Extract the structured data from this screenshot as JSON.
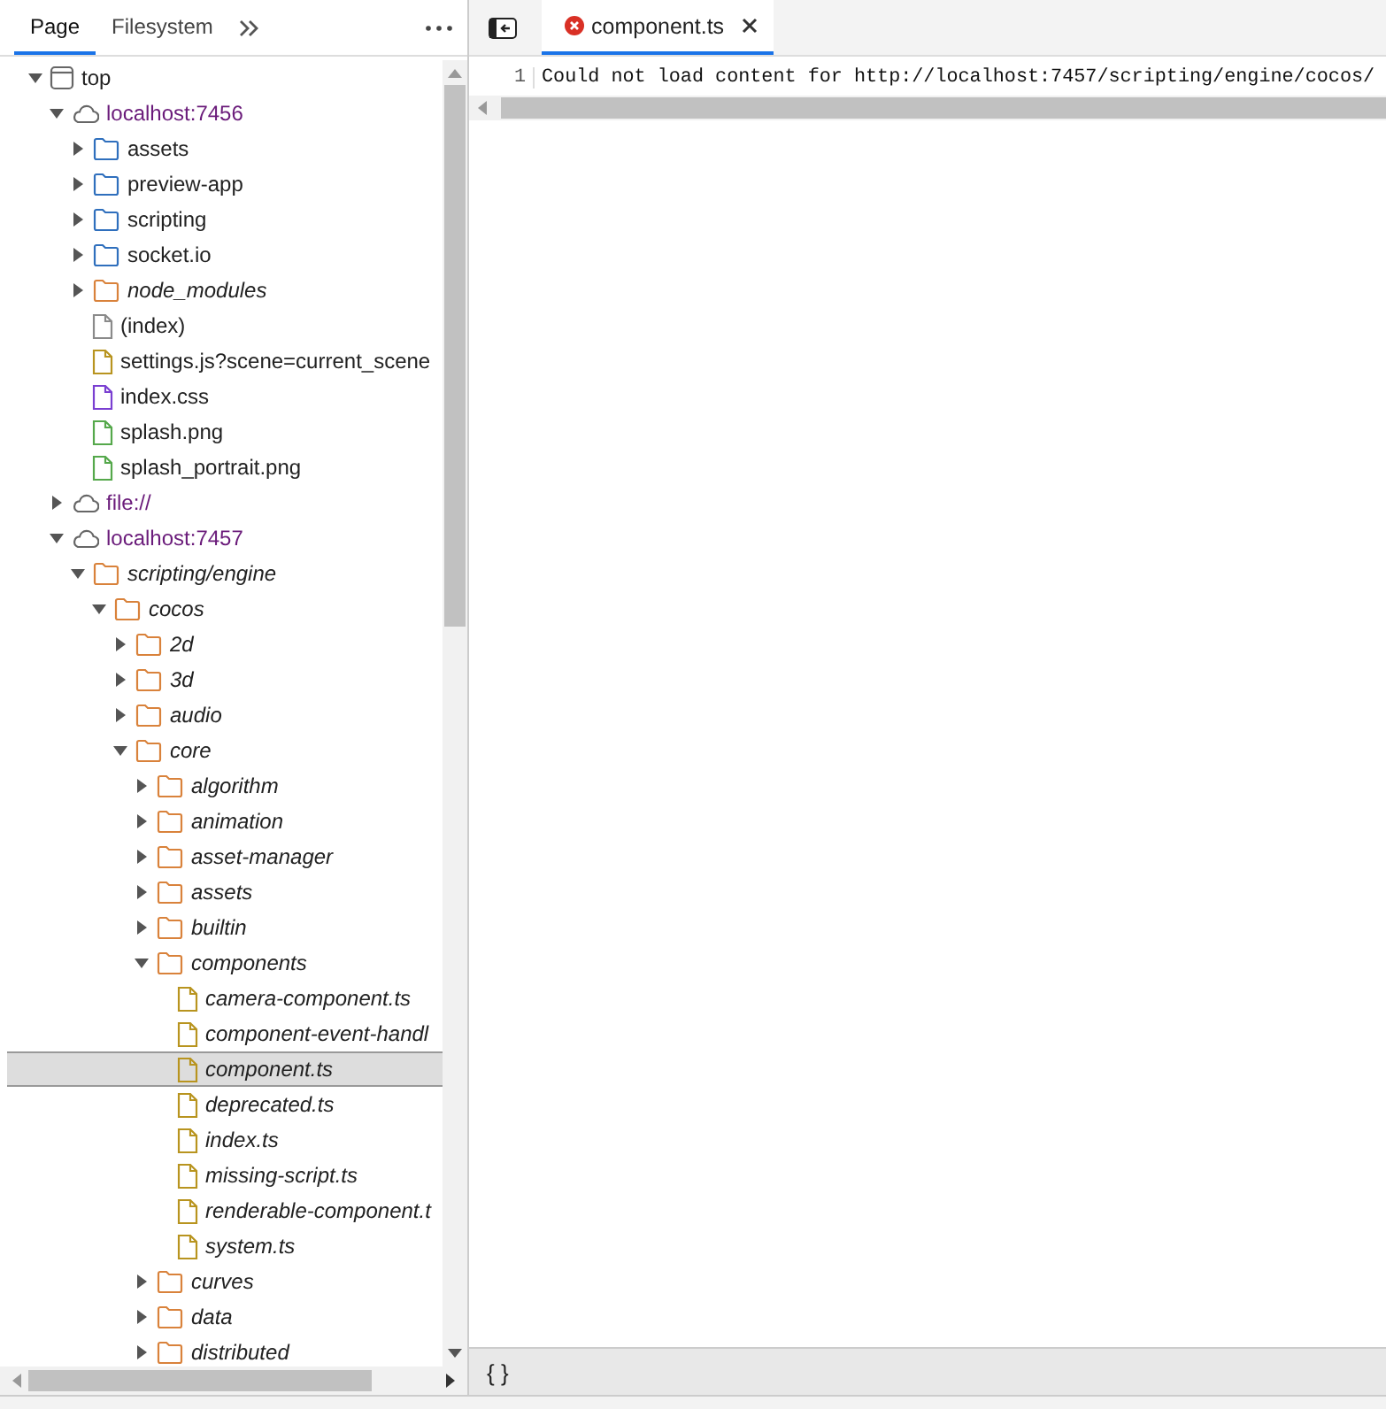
{
  "navigator": {
    "tabs": [
      {
        "label": "Page",
        "selected": true
      },
      {
        "label": "Filesystem",
        "selected": false
      }
    ],
    "tree": [
      {
        "label": "top",
        "kind": "frame",
        "expanded": true,
        "selected": false,
        "children": [
          {
            "label": "localhost:7456",
            "kind": "origin",
            "expanded": true,
            "selected": false,
            "children": [
              {
                "label": "assets",
                "kind": "folder",
                "color": "#2f6fbd",
                "italic": false,
                "expanded": false,
                "selected": false
              },
              {
                "label": "preview-app",
                "kind": "folder",
                "color": "#2f6fbd",
                "italic": false,
                "expanded": false,
                "selected": false
              },
              {
                "label": "scripting",
                "kind": "folder",
                "color": "#2f6fbd",
                "italic": false,
                "expanded": false,
                "selected": false
              },
              {
                "label": "socket.io",
                "kind": "folder",
                "color": "#2f6fbd",
                "italic": false,
                "expanded": false,
                "selected": false
              },
              {
                "label": "node_modules",
                "kind": "folder",
                "color": "#d9823b",
                "italic": true,
                "expanded": false,
                "selected": false
              },
              {
                "label": "(index)",
                "kind": "file",
                "color": "#8a8a8a",
                "italic": false,
                "selected": false
              },
              {
                "label": "settings.js?scene=current_scene",
                "kind": "file",
                "color": "#b8941f",
                "italic": false,
                "selected": false
              },
              {
                "label": "index.css",
                "kind": "file",
                "color": "#7a3fd1",
                "italic": false,
                "selected": false
              },
              {
                "label": "splash.png",
                "kind": "file",
                "color": "#55a84b",
                "italic": false,
                "selected": false
              },
              {
                "label": "splash_portrait.png",
                "kind": "file",
                "color": "#55a84b",
                "italic": false,
                "selected": false
              }
            ]
          },
          {
            "label": "file://",
            "kind": "origin",
            "expanded": false,
            "selected": false
          },
          {
            "label": "localhost:7457",
            "kind": "origin",
            "expanded": true,
            "selected": false,
            "children": [
              {
                "label": "scripting/engine",
                "kind": "folder",
                "color": "#d9823b",
                "italic": true,
                "expanded": true,
                "selected": false,
                "children": [
                  {
                    "label": "cocos",
                    "kind": "folder",
                    "color": "#d9823b",
                    "italic": true,
                    "expanded": true,
                    "selected": false,
                    "children": [
                      {
                        "label": "2d",
                        "kind": "folder",
                        "color": "#d9823b",
                        "italic": true,
                        "expanded": false,
                        "selected": false
                      },
                      {
                        "label": "3d",
                        "kind": "folder",
                        "color": "#d9823b",
                        "italic": true,
                        "expanded": false,
                        "selected": false
                      },
                      {
                        "label": "audio",
                        "kind": "folder",
                        "color": "#d9823b",
                        "italic": true,
                        "expanded": false,
                        "selected": false
                      },
                      {
                        "label": "core",
                        "kind": "folder",
                        "color": "#d9823b",
                        "italic": true,
                        "expanded": true,
                        "selected": false,
                        "children": [
                          {
                            "label": "algorithm",
                            "kind": "folder",
                            "color": "#d9823b",
                            "italic": true,
                            "expanded": false,
                            "selected": false
                          },
                          {
                            "label": "animation",
                            "kind": "folder",
                            "color": "#d9823b",
                            "italic": true,
                            "expanded": false,
                            "selected": false
                          },
                          {
                            "label": "asset-manager",
                            "kind": "folder",
                            "color": "#d9823b",
                            "italic": true,
                            "expanded": false,
                            "selected": false
                          },
                          {
                            "label": "assets",
                            "kind": "folder",
                            "color": "#d9823b",
                            "italic": true,
                            "expanded": false,
                            "selected": false
                          },
                          {
                            "label": "builtin",
                            "kind": "folder",
                            "color": "#d9823b",
                            "italic": true,
                            "expanded": false,
                            "selected": false
                          },
                          {
                            "label": "components",
                            "kind": "folder",
                            "color": "#d9823b",
                            "italic": true,
                            "expanded": true,
                            "selected": false,
                            "children": [
                              {
                                "label": "camera-component.ts",
                                "kind": "file",
                                "color": "#b8941f",
                                "italic": true,
                                "selected": false
                              },
                              {
                                "label": "component-event-handl",
                                "kind": "file",
                                "color": "#b8941f",
                                "italic": true,
                                "selected": false
                              },
                              {
                                "label": "component.ts",
                                "kind": "file",
                                "color": "#b8941f",
                                "italic": true,
                                "selected": true
                              },
                              {
                                "label": "deprecated.ts",
                                "kind": "file",
                                "color": "#b8941f",
                                "italic": true,
                                "selected": false
                              },
                              {
                                "label": "index.ts",
                                "kind": "file",
                                "color": "#b8941f",
                                "italic": true,
                                "selected": false
                              },
                              {
                                "label": "missing-script.ts",
                                "kind": "file",
                                "color": "#b8941f",
                                "italic": true,
                                "selected": false
                              },
                              {
                                "label": "renderable-component.t",
                                "kind": "file",
                                "color": "#b8941f",
                                "italic": true,
                                "selected": false
                              },
                              {
                                "label": "system.ts",
                                "kind": "file",
                                "color": "#b8941f",
                                "italic": true,
                                "selected": false
                              }
                            ]
                          },
                          {
                            "label": "curves",
                            "kind": "folder",
                            "color": "#d9823b",
                            "italic": true,
                            "expanded": false,
                            "selected": false
                          },
                          {
                            "label": "data",
                            "kind": "folder",
                            "color": "#d9823b",
                            "italic": true,
                            "expanded": false,
                            "selected": false
                          },
                          {
                            "label": "distributed",
                            "kind": "folder",
                            "color": "#d9823b",
                            "italic": true,
                            "expanded": false,
                            "selected": false
                          }
                        ]
                      }
                    ]
                  }
                ]
              }
            ]
          }
        ]
      }
    ]
  },
  "editor": {
    "tab": {
      "label": "component.ts",
      "error": true
    },
    "lines": [
      {
        "number": "1",
        "text": "Could not load content for http://localhost:7457/scripting/engine/cocos/"
      }
    ],
    "status": "{ }"
  }
}
